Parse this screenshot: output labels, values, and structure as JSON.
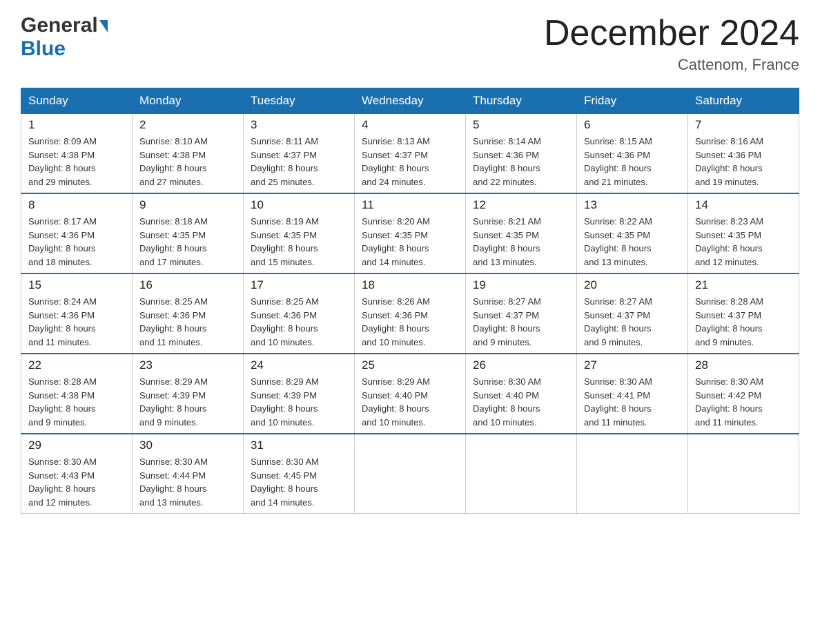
{
  "header": {
    "logo_general": "General",
    "logo_blue": "Blue",
    "month_title": "December 2024",
    "location": "Cattenom, France"
  },
  "days_of_week": [
    "Sunday",
    "Monday",
    "Tuesday",
    "Wednesday",
    "Thursday",
    "Friday",
    "Saturday"
  ],
  "weeks": [
    [
      {
        "num": "1",
        "sunrise": "8:09 AM",
        "sunset": "4:38 PM",
        "daylight": "8 hours and 29 minutes."
      },
      {
        "num": "2",
        "sunrise": "8:10 AM",
        "sunset": "4:38 PM",
        "daylight": "8 hours and 27 minutes."
      },
      {
        "num": "3",
        "sunrise": "8:11 AM",
        "sunset": "4:37 PM",
        "daylight": "8 hours and 25 minutes."
      },
      {
        "num": "4",
        "sunrise": "8:13 AM",
        "sunset": "4:37 PM",
        "daylight": "8 hours and 24 minutes."
      },
      {
        "num": "5",
        "sunrise": "8:14 AM",
        "sunset": "4:36 PM",
        "daylight": "8 hours and 22 minutes."
      },
      {
        "num": "6",
        "sunrise": "8:15 AM",
        "sunset": "4:36 PM",
        "daylight": "8 hours and 21 minutes."
      },
      {
        "num": "7",
        "sunrise": "8:16 AM",
        "sunset": "4:36 PM",
        "daylight": "8 hours and 19 minutes."
      }
    ],
    [
      {
        "num": "8",
        "sunrise": "8:17 AM",
        "sunset": "4:36 PM",
        "daylight": "8 hours and 18 minutes."
      },
      {
        "num": "9",
        "sunrise": "8:18 AM",
        "sunset": "4:35 PM",
        "daylight": "8 hours and 17 minutes."
      },
      {
        "num": "10",
        "sunrise": "8:19 AM",
        "sunset": "4:35 PM",
        "daylight": "8 hours and 15 minutes."
      },
      {
        "num": "11",
        "sunrise": "8:20 AM",
        "sunset": "4:35 PM",
        "daylight": "8 hours and 14 minutes."
      },
      {
        "num": "12",
        "sunrise": "8:21 AM",
        "sunset": "4:35 PM",
        "daylight": "8 hours and 13 minutes."
      },
      {
        "num": "13",
        "sunrise": "8:22 AM",
        "sunset": "4:35 PM",
        "daylight": "8 hours and 13 minutes."
      },
      {
        "num": "14",
        "sunrise": "8:23 AM",
        "sunset": "4:35 PM",
        "daylight": "8 hours and 12 minutes."
      }
    ],
    [
      {
        "num": "15",
        "sunrise": "8:24 AM",
        "sunset": "4:36 PM",
        "daylight": "8 hours and 11 minutes."
      },
      {
        "num": "16",
        "sunrise": "8:25 AM",
        "sunset": "4:36 PM",
        "daylight": "8 hours and 11 minutes."
      },
      {
        "num": "17",
        "sunrise": "8:25 AM",
        "sunset": "4:36 PM",
        "daylight": "8 hours and 10 minutes."
      },
      {
        "num": "18",
        "sunrise": "8:26 AM",
        "sunset": "4:36 PM",
        "daylight": "8 hours and 10 minutes."
      },
      {
        "num": "19",
        "sunrise": "8:27 AM",
        "sunset": "4:37 PM",
        "daylight": "8 hours and 9 minutes."
      },
      {
        "num": "20",
        "sunrise": "8:27 AM",
        "sunset": "4:37 PM",
        "daylight": "8 hours and 9 minutes."
      },
      {
        "num": "21",
        "sunrise": "8:28 AM",
        "sunset": "4:37 PM",
        "daylight": "8 hours and 9 minutes."
      }
    ],
    [
      {
        "num": "22",
        "sunrise": "8:28 AM",
        "sunset": "4:38 PM",
        "daylight": "8 hours and 9 minutes."
      },
      {
        "num": "23",
        "sunrise": "8:29 AM",
        "sunset": "4:39 PM",
        "daylight": "8 hours and 9 minutes."
      },
      {
        "num": "24",
        "sunrise": "8:29 AM",
        "sunset": "4:39 PM",
        "daylight": "8 hours and 10 minutes."
      },
      {
        "num": "25",
        "sunrise": "8:29 AM",
        "sunset": "4:40 PM",
        "daylight": "8 hours and 10 minutes."
      },
      {
        "num": "26",
        "sunrise": "8:30 AM",
        "sunset": "4:40 PM",
        "daylight": "8 hours and 10 minutes."
      },
      {
        "num": "27",
        "sunrise": "8:30 AM",
        "sunset": "4:41 PM",
        "daylight": "8 hours and 11 minutes."
      },
      {
        "num": "28",
        "sunrise": "8:30 AM",
        "sunset": "4:42 PM",
        "daylight": "8 hours and 11 minutes."
      }
    ],
    [
      {
        "num": "29",
        "sunrise": "8:30 AM",
        "sunset": "4:43 PM",
        "daylight": "8 hours and 12 minutes."
      },
      {
        "num": "30",
        "sunrise": "8:30 AM",
        "sunset": "4:44 PM",
        "daylight": "8 hours and 13 minutes."
      },
      {
        "num": "31",
        "sunrise": "8:30 AM",
        "sunset": "4:45 PM",
        "daylight": "8 hours and 14 minutes."
      },
      null,
      null,
      null,
      null
    ]
  ],
  "labels": {
    "sunrise": "Sunrise:",
    "sunset": "Sunset:",
    "daylight": "Daylight:"
  }
}
